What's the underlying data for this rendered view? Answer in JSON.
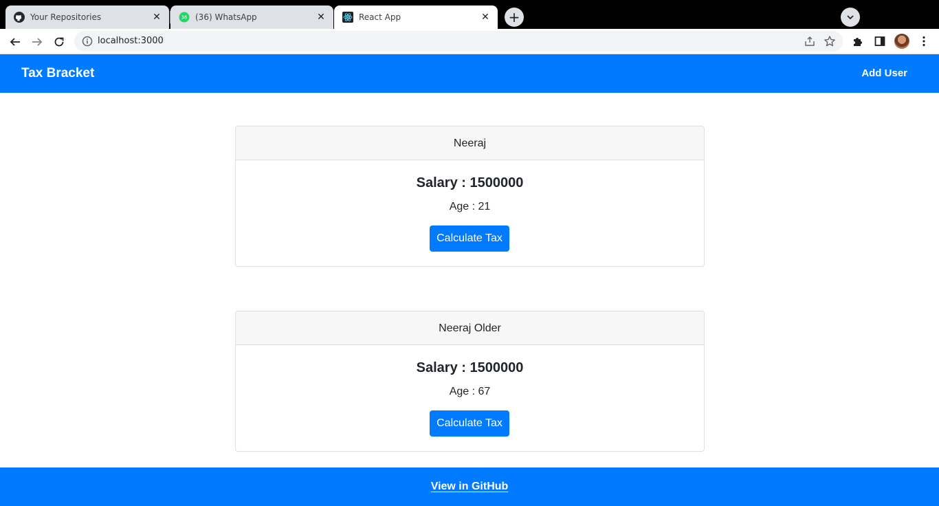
{
  "browser": {
    "tabs": [
      {
        "title": "Your Repositories",
        "icon": "github-icon",
        "active": false
      },
      {
        "title": "(36) WhatsApp",
        "icon": "whatsapp-icon",
        "badge": "36",
        "active": false
      },
      {
        "title": "React App",
        "icon": "react-icon",
        "active": true
      }
    ],
    "close_glyph": "✕",
    "new_tab_glyph": "+",
    "url": "localhost:3000"
  },
  "navbar": {
    "brand": "Tax Bracket",
    "add_user_label": "Add User",
    "color": "#007bff"
  },
  "users": [
    {
      "name": "Neeraj",
      "salary_text": "Salary : 1500000",
      "age_text": "Age : 21",
      "button_label": "Calculate Tax"
    },
    {
      "name": "Neeraj Older",
      "salary_text": "Salary : 1500000",
      "age_text": "Age : 67",
      "button_label": "Calculate Tax"
    }
  ],
  "footer": {
    "link_label": "View in GitHub"
  }
}
